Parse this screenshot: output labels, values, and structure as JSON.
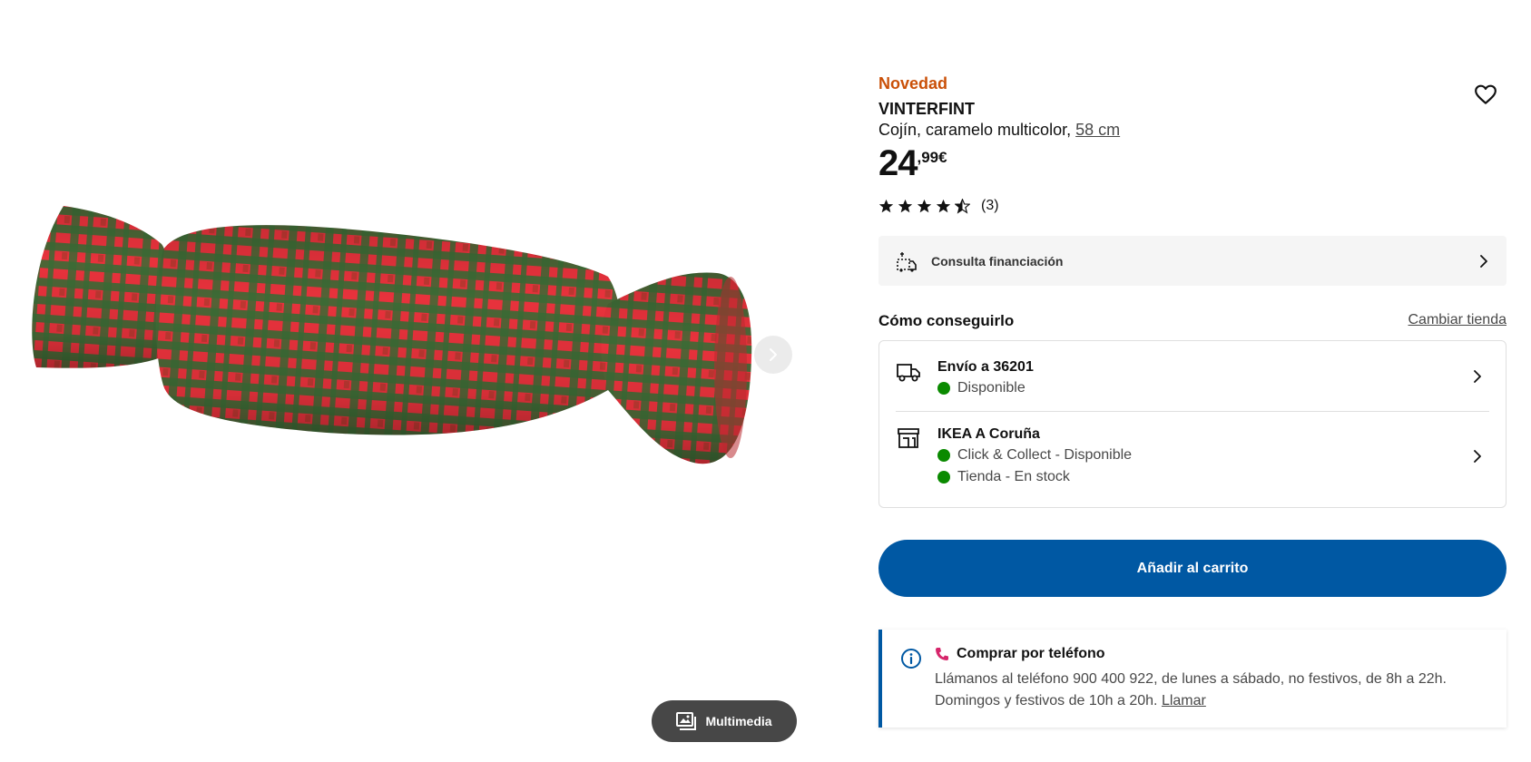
{
  "gallery": {
    "multimedia_label": "Multimedia",
    "colors": {
      "red": "#e8323c",
      "green": "#3b6b35"
    }
  },
  "product": {
    "badge": "Novedad",
    "name": "VINTERFINT",
    "description": "Cojín, caramelo multicolor,",
    "measure": "58 cm",
    "price_integer": "24",
    "price_decimal": ",99",
    "price_currency": "€",
    "rating_value": 4.5,
    "rating_max": 5,
    "rating_count": "(3)"
  },
  "finance": {
    "label": "Consulta financiación"
  },
  "availability": {
    "title": "Cómo conseguirlo",
    "change_store": "Cambiar tienda",
    "delivery": {
      "title": "Envío a 36201",
      "status": "Disponible"
    },
    "store": {
      "title": "IKEA A Coruña",
      "status_collect": "Click & Collect - Disponible",
      "status_store": "Tienda - En stock"
    },
    "status_color": "#0a8a00"
  },
  "cart": {
    "add_label": "Añadir al carrito",
    "color": "#0058a3"
  },
  "phone": {
    "title": "Comprar por teléfono",
    "text_line1": "Llámanos al teléfono 900 400 922, de lunes a sábado, no festivos, de 8h a 22h.",
    "text_line2": "Domingos y festivos de 10h a 20h.",
    "call_link": "Llamar"
  },
  "brand": {
    "accent": "#0058a3",
    "new_color": "#ca5008"
  }
}
